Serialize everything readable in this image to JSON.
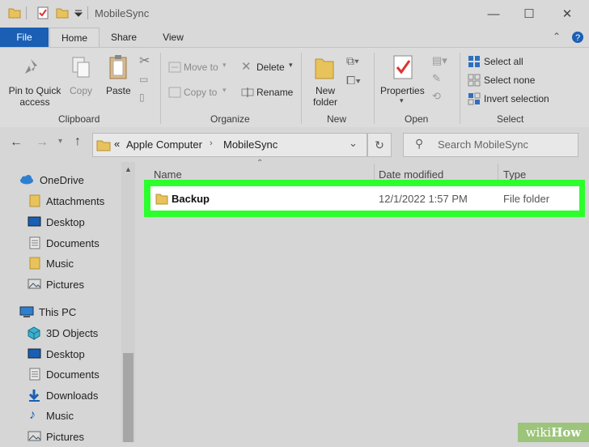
{
  "window": {
    "title": "MobileSync"
  },
  "tabs": [
    {
      "label": "File"
    },
    {
      "label": "Home"
    },
    {
      "label": "Share"
    },
    {
      "label": "View"
    }
  ],
  "ribbon": {
    "clipboard": {
      "pin_label": "Pin to Quick access",
      "copy_label": "Copy",
      "paste_label": "Paste",
      "group_label": "Clipboard"
    },
    "organize": {
      "move_to": "Move to",
      "copy_to": "Copy to",
      "delete": "Delete",
      "rename": "Rename",
      "group_label": "Organize"
    },
    "new": {
      "new_folder": "New folder",
      "group_label": "New"
    },
    "open": {
      "properties": "Properties",
      "group_label": "Open"
    },
    "select": {
      "select_all": "Select all",
      "select_none": "Select none",
      "invert_selection": "Invert selection",
      "group_label": "Select"
    }
  },
  "address": {
    "prefix": "«",
    "crumbs": [
      "Apple Computer",
      "MobileSync"
    ],
    "search_placeholder": "Search MobileSync"
  },
  "sidebar": {
    "items": [
      {
        "label": "OneDrive",
        "icon": "cloud-icon"
      },
      {
        "label": "Attachments",
        "icon": "folder-icon"
      },
      {
        "label": "Desktop",
        "icon": "desktop-icon"
      },
      {
        "label": "Documents",
        "icon": "documents-icon"
      },
      {
        "label": "Music",
        "icon": "folder-icon"
      },
      {
        "label": "Pictures",
        "icon": "pictures-icon"
      },
      {
        "label": "This PC",
        "icon": "computer-icon"
      },
      {
        "label": "3D Objects",
        "icon": "cube-icon"
      },
      {
        "label": "Desktop",
        "icon": "desktop-icon"
      },
      {
        "label": "Documents",
        "icon": "documents-icon"
      },
      {
        "label": "Downloads",
        "icon": "download-icon"
      },
      {
        "label": "Music",
        "icon": "music-icon"
      },
      {
        "label": "Pictures",
        "icon": "pictures-icon"
      }
    ]
  },
  "files": {
    "columns": {
      "name": "Name",
      "date": "Date modified",
      "type": "Type"
    },
    "rows": [
      {
        "name": "Backup",
        "date": "12/1/2022 1:57 PM",
        "type": "File folder"
      }
    ]
  },
  "watermark": {
    "brand_a": "wiki",
    "brand_b": "How"
  },
  "colors": {
    "file_tab": "#1a5fb4",
    "highlight": "#2cff2c",
    "folder": "#e8c25a"
  }
}
